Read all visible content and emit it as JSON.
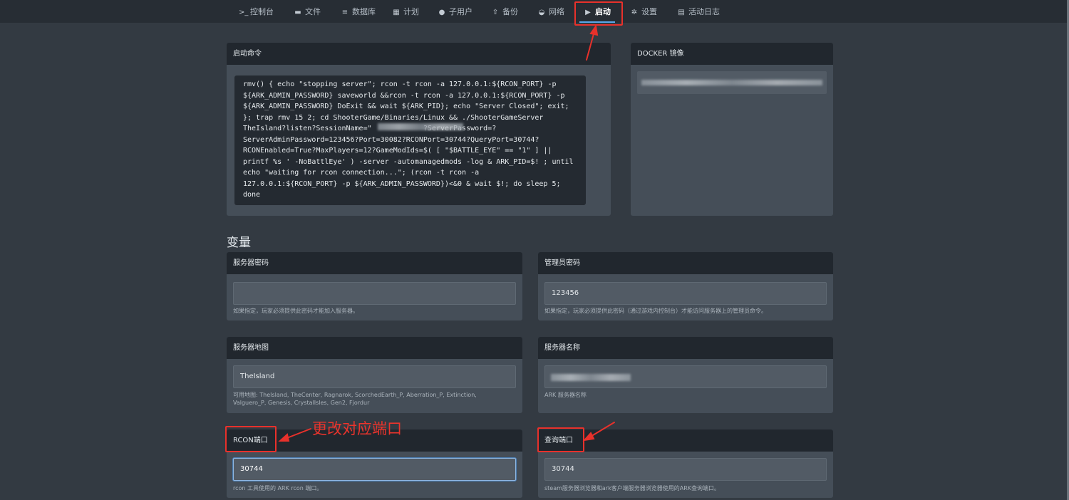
{
  "nav": {
    "console": "控制台",
    "files": "文件",
    "database": "数据库",
    "schedule": "计划",
    "subusers": "子用户",
    "backups": "备份",
    "network": "网络",
    "startup": "启动",
    "settings": "设置",
    "activity": "活动日志"
  },
  "startup": {
    "title": "启动命令",
    "command": "rmv() { echo \"stopping server\"; rcon -t rcon -a 127.0.0.1:${RCON_PORT} -p\n${ARK_ADMIN_PASSWORD} saveworld &&rcon -t rcon -a 127.0.0.1:${RCON_PORT} -p\n${ARK_ADMIN_PASSWORD} DoExit && wait ${ARK_PID}; echo \"Server Closed\"; exit;\n}; trap rmv 15 2; cd ShooterGame/Binaries/Linux && ./ShooterGameServer\nTheIsland?listen?SessionName=\"            ?ServerPassword=?\nServerAdminPassword=123456?Port=30082?RCONPort=30744?QueryPort=30744?\nRCONEnabled=True?MaxPlayers=12?GameModIds=$( [ \"$BATTLE_EYE\" == \"1\" ] ||\nprintf %s ' -NoBattlEye' ) -server -automanagedmods -log & ARK_PID=$! ; until\necho \"waiting for rcon connection...\"; (rcon -t rcon -a\n127.0.0.1:${RCON_PORT} -p ${ARK_ADMIN_PASSWORD})<&0 & wait $!; do sleep 5;\ndone"
  },
  "docker": {
    "title": "DOCKER 镜像"
  },
  "variables": {
    "heading": "变量",
    "server_password": {
      "label": "服务器密码",
      "value": "",
      "help": "如果指定，玩家必须提供此密码才能加入服务器。"
    },
    "admin_password": {
      "label": "管理员密码",
      "value": "123456",
      "help": "如果指定，玩家必须提供此密码（通过游戏内控制台）才能访问服务器上的管理员命令。"
    },
    "server_map": {
      "label": "服务器地图",
      "value": "TheIsland",
      "help": "可用地图: TheIsland, TheCenter, Ragnarok, ScorchedEarth_P, Aberration_P, Extinction, Valguero_P, Genesis, CrystalIsles, Gen2, Fjordur"
    },
    "server_name": {
      "label": "服务器名称",
      "value": "",
      "help": "ARK 服务器名称"
    },
    "rcon_port": {
      "label": "RCON端口",
      "value": "30744",
      "help": "rcon 工具使用的 ARK rcon 端口。"
    },
    "query_port": {
      "label": "查询端口",
      "value": "30744",
      "help": "steam服务器浏览器和ark客户端服务器浏览器使用的ARK查询端口。"
    }
  },
  "annotation": {
    "text": "更改对应端口"
  },
  "colors": {
    "annotation": "#e8312b",
    "active_tab": "#5aa6e8",
    "background": "#333a42"
  }
}
